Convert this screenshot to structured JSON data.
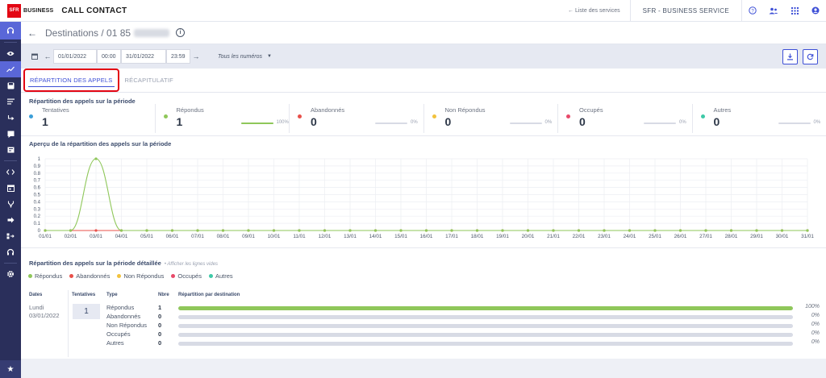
{
  "header": {
    "logo_text": "SFR",
    "logo_sub": "BUSINESS",
    "app_title": "CALL CONTACT",
    "service_link": "← Liste des services",
    "org_name": "SFR - BUSINESS SERVICE"
  },
  "breadcrumb": {
    "title": "Destinations / 01 85"
  },
  "filters": {
    "date_from": "01/01/2022",
    "time_from": "00:00",
    "date_to": "31/01/2022",
    "time_to": "23:59",
    "numbers_select": "Tous les numéros"
  },
  "tabs": [
    {
      "label": "RÉPARTITION DES APPELS"
    },
    {
      "label": "RÉCAPITULATIF"
    }
  ],
  "summary": {
    "title": "Répartition des appels sur la période",
    "stats": [
      {
        "label": "Tentatives",
        "value": "1",
        "color": "#3b9ed8"
      },
      {
        "label": "Répondus",
        "value": "1",
        "pct": "100%",
        "fill": 1.0,
        "color": "#8fc75a"
      },
      {
        "label": "Abandonnés",
        "value": "0",
        "pct": "0%",
        "fill": 0,
        "color": "#e8504a"
      },
      {
        "label": "Non Répondus",
        "value": "0",
        "pct": "0%",
        "fill": 0,
        "color": "#f2c23d"
      },
      {
        "label": "Occupés",
        "value": "0",
        "pct": "0%",
        "fill": 0,
        "color": "#e84a6a"
      },
      {
        "label": "Autres",
        "value": "0",
        "pct": "0%",
        "fill": 0,
        "color": "#3ec9a7"
      }
    ]
  },
  "chart_title": "Aperçu de la répartition des appels sur la période",
  "chart_data": {
    "type": "line",
    "ylim": [
      0,
      1
    ],
    "y_ticks": [
      "0",
      "0.1",
      "0.2",
      "0.3",
      "0.4",
      "0.5",
      "0.6",
      "0.7",
      "0.8",
      "0.9",
      "1"
    ],
    "categories": [
      "01/01",
      "02/01",
      "03/01",
      "04/01",
      "05/01",
      "06/01",
      "07/01",
      "08/01",
      "09/01",
      "10/01",
      "11/01",
      "12/01",
      "13/01",
      "14/01",
      "15/01",
      "16/01",
      "17/01",
      "18/01",
      "19/01",
      "20/01",
      "21/01",
      "22/01",
      "23/01",
      "24/01",
      "25/01",
      "26/01",
      "27/01",
      "28/01",
      "29/01",
      "30/01",
      "31/01"
    ],
    "series": [
      {
        "name": "Répondus",
        "color": "#8fc75a",
        "values": [
          0,
          0,
          1,
          0,
          0,
          0,
          0,
          0,
          0,
          0,
          0,
          0,
          0,
          0,
          0,
          0,
          0,
          0,
          0,
          0,
          0,
          0,
          0,
          0,
          0,
          0,
          0,
          0,
          0,
          0,
          0
        ]
      },
      {
        "name": "Abandonnés",
        "color": "#e8504a",
        "values": [
          0,
          0,
          0,
          0,
          0,
          0,
          0,
          0,
          0,
          0,
          0,
          0,
          0,
          0,
          0,
          0,
          0,
          0,
          0,
          0,
          0,
          0,
          0,
          0,
          0,
          0,
          0,
          0,
          0,
          0,
          0
        ]
      }
    ]
  },
  "detail": {
    "title": "Répartition des appels sur la période détaillée",
    "hint": "• Afficher les lignes vides",
    "legend": [
      {
        "label": "Répondus",
        "color": "#8fc75a"
      },
      {
        "label": "Abandonnés",
        "color": "#e8504a"
      },
      {
        "label": "Non Répondus",
        "color": "#f2c23d"
      },
      {
        "label": "Occupés",
        "color": "#e84a6a"
      },
      {
        "label": "Autres",
        "color": "#3ec9a7"
      }
    ],
    "headers": {
      "dates": "Dates",
      "tentatives": "Tentatives",
      "type": "Type",
      "nbre": "Nbre",
      "repartition": "Répartition par destination"
    },
    "day": "Lundi",
    "date": "03/01/2022",
    "tentatives": "1",
    "rows": [
      {
        "type": "Répondus",
        "nbre": "1",
        "pct": "100%",
        "fill": 1.0
      },
      {
        "type": "Abandonnés",
        "nbre": "0",
        "pct": "0%",
        "fill": 0
      },
      {
        "type": "Non Répondus",
        "nbre": "0",
        "pct": "0%",
        "fill": 0
      },
      {
        "type": "Occupés",
        "nbre": "0",
        "pct": "0%",
        "fill": 0
      },
      {
        "type": "Autres",
        "nbre": "0",
        "pct": "0%",
        "fill": 0
      }
    ]
  }
}
